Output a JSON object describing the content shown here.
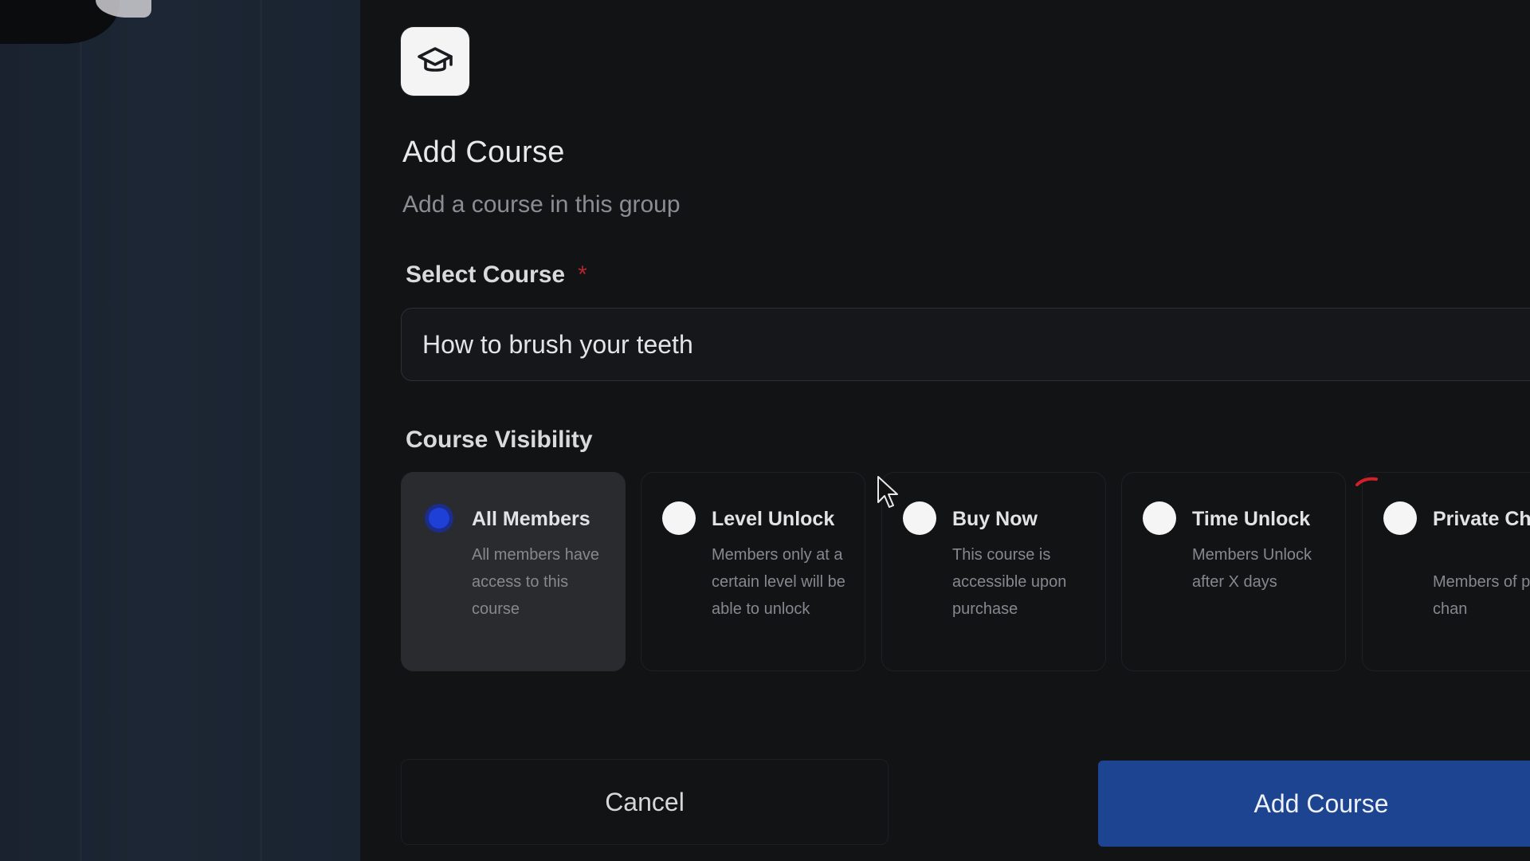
{
  "modal": {
    "icon": "graduation-cap-icon",
    "title": "Add Course",
    "subtitle": "Add a course in this group",
    "select_course": {
      "label": "Select Course",
      "required_marker": "*",
      "value": "How to brush your teeth"
    },
    "visibility": {
      "label": "Course Visibility",
      "options": [
        {
          "title": "All Members",
          "description": "All members have access to this course",
          "selected": true
        },
        {
          "title": "Level Unlock",
          "description": "Members only at a certain level will be able to unlock",
          "selected": false
        },
        {
          "title": "Buy Now",
          "description": "This course is accessible upon purchase",
          "selected": false
        },
        {
          "title": "Time Unlock",
          "description": "Members Unlock after X days",
          "selected": false
        },
        {
          "title": "Private Channel",
          "description": "Members of private chan",
          "selected": false
        }
      ]
    },
    "buttons": {
      "cancel": "Cancel",
      "submit": "Add Course"
    }
  },
  "colors": {
    "accent": "#1c4491",
    "radio_selected": "#1e40d6",
    "required": "#b3262c"
  }
}
